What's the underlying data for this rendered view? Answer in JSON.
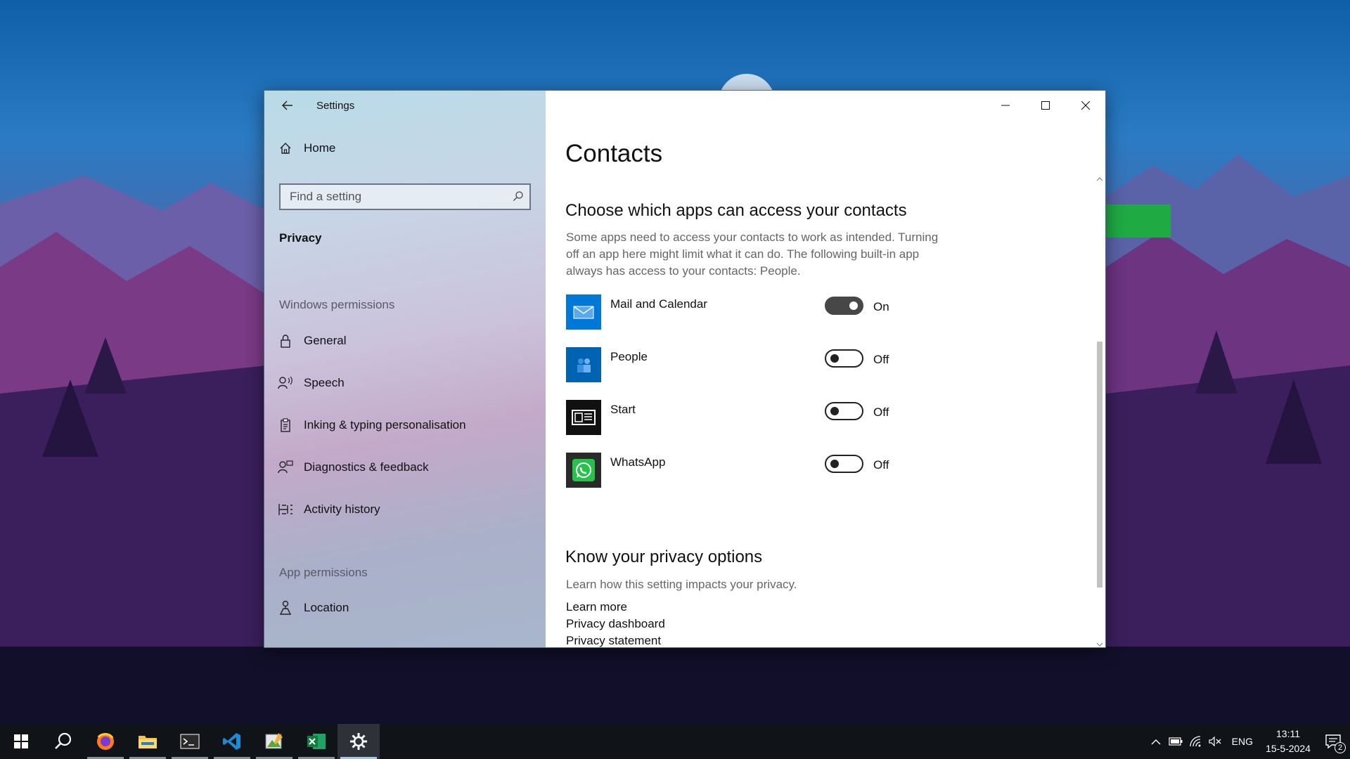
{
  "window": {
    "title": "Settings",
    "minimize_label": "Minimize",
    "maximize_label": "Maximize",
    "close_label": "Close"
  },
  "sidebar": {
    "home_label": "Home",
    "search_placeholder": "Find a setting",
    "current_section": "Privacy",
    "windows_permissions": {
      "heading": "Windows permissions",
      "items": [
        {
          "label": "General",
          "icon": "lock-icon"
        },
        {
          "label": "Speech",
          "icon": "speech-icon"
        },
        {
          "label": "Inking & typing personalisation",
          "icon": "clipboard-icon"
        },
        {
          "label": "Diagnostics & feedback",
          "icon": "feedback-icon"
        },
        {
          "label": "Activity history",
          "icon": "activity-icon"
        }
      ]
    },
    "app_permissions": {
      "heading": "App permissions",
      "items": [
        {
          "label": "Location",
          "icon": "location-icon"
        }
      ]
    }
  },
  "main": {
    "title": "Contacts",
    "subheading": "Choose which apps can access your contacts",
    "description": "Some apps need to access your contacts to work as intended. Turning off an app here might limit what it can do. The following built-in app always has access to your contacts: People.",
    "apps": [
      {
        "name": "Mail and Calendar",
        "state": "On",
        "enabled": true,
        "tile_color": "#0078d7"
      },
      {
        "name": "People",
        "state": "Off",
        "enabled": false,
        "tile_color": "#0063b1"
      },
      {
        "name": "Start",
        "state": "Off",
        "enabled": false,
        "tile_color": "#111111"
      },
      {
        "name": "WhatsApp",
        "state": "Off",
        "enabled": false,
        "tile_color": "#2a2a2a"
      }
    ],
    "privacy_section": {
      "heading": "Know your privacy options",
      "description": "Learn how this setting impacts your privacy.",
      "links": [
        "Learn more",
        "Privacy dashboard",
        "Privacy statement"
      ]
    }
  },
  "taskbar": {
    "apps": [
      "start-icon",
      "search-icon",
      "firefox-icon",
      "file-explorer-icon",
      "terminal-icon",
      "vscode-icon",
      "image-editor-icon",
      "excel-icon",
      "settings-icon"
    ],
    "language": "ENG",
    "time": "13:11",
    "date": "15-5-2024",
    "notification_count": "2"
  },
  "colors": {
    "annotation_arrow": "#1faa44",
    "accent": "#0078d7"
  }
}
